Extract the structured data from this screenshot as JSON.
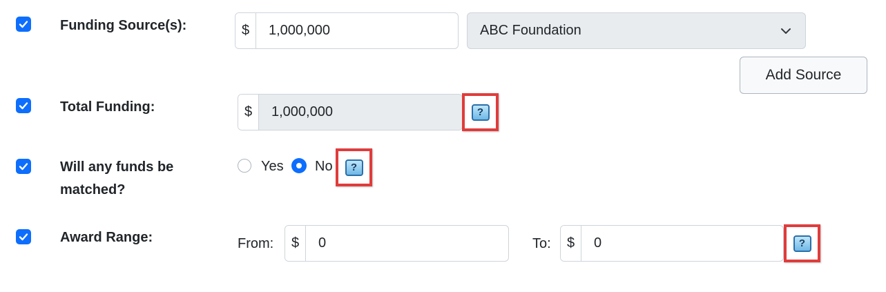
{
  "funding_sources": {
    "label": "Funding Source(s):",
    "currency_symbol": "$",
    "amount": "1,000,000",
    "source_selected": "ABC Foundation",
    "add_source_label": "Add Source"
  },
  "total_funding": {
    "label": "Total Funding:",
    "currency_symbol": "$",
    "amount": "1,000,000",
    "help_symbol": "?"
  },
  "matched": {
    "label_line1": "Will any funds be",
    "label_line2": "matched?",
    "option_yes": "Yes",
    "option_no": "No",
    "selected": "No",
    "help_symbol": "?"
  },
  "award_range": {
    "label": "Award Range:",
    "from_label": "From:",
    "from_currency": "$",
    "from_value": "0",
    "to_label": "To:",
    "to_currency": "$",
    "to_value": "0",
    "help_symbol": "?"
  },
  "colors": {
    "accent": "#0d6efd",
    "highlight_border": "#e03c3c"
  }
}
